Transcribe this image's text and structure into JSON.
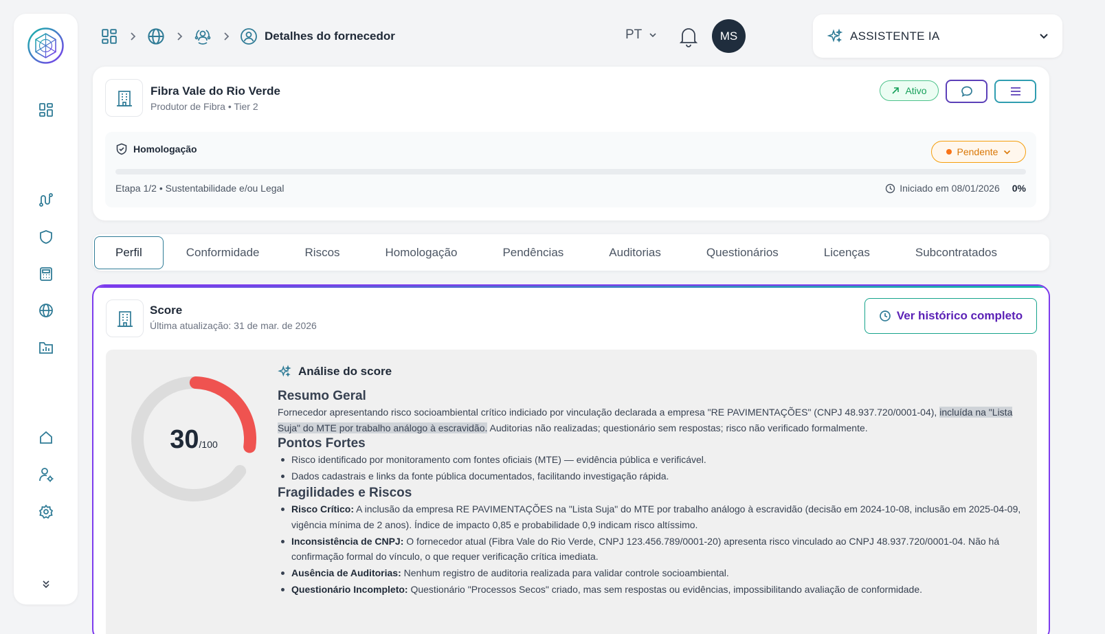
{
  "colors": {
    "accent": "#2f7b96",
    "purple": "#7c3aed",
    "teal": "#14b8a6",
    "danger": "#ef5350",
    "pending": "#d97706",
    "active": "#16a05a"
  },
  "sidebar": {
    "items": [
      {
        "name": "dashboard",
        "icon": "dashboard-icon"
      },
      {
        "name": "routes",
        "icon": "route-icon"
      },
      {
        "name": "shield",
        "icon": "shield-icon"
      },
      {
        "name": "calculator",
        "icon": "calculator-icon"
      },
      {
        "name": "globe",
        "icon": "globe-icon"
      },
      {
        "name": "reports",
        "icon": "chart-folder-icon"
      },
      {
        "name": "home",
        "icon": "home-icon"
      },
      {
        "name": "user-settings",
        "icon": "user-gear-icon"
      },
      {
        "name": "settings",
        "icon": "gear-icon"
      },
      {
        "name": "expand",
        "icon": "chevrons-down-icon"
      }
    ]
  },
  "header": {
    "breadcrumb_current": "Detalhes do fornecedor",
    "language": "PT",
    "avatar_initials": "MS",
    "assistant_label": "ASSISTENTE IA"
  },
  "supplier": {
    "name": "Fibra Vale do Rio Verde",
    "subtitle": "Produtor de Fibra • Tier 2",
    "status": "Ativo",
    "homologation": {
      "title": "Homologação",
      "status": "Pendente",
      "stage": "Etapa 1/2 • Sustentabilidade e/ou Legal",
      "started": "Iniciado em 08/01/2026",
      "percent_label": "0%",
      "progress": 0
    }
  },
  "tabs": [
    {
      "label": "Perfil",
      "active": true
    },
    {
      "label": "Conformidade",
      "active": false
    },
    {
      "label": "Riscos",
      "active": false
    },
    {
      "label": "Homologação",
      "active": false
    },
    {
      "label": "Pendências",
      "active": false
    },
    {
      "label": "Auditorias",
      "active": false
    },
    {
      "label": "Questionários",
      "active": false
    },
    {
      "label": "Licenças",
      "active": false
    },
    {
      "label": "Subcontratados",
      "active": false
    }
  ],
  "score": {
    "title": "Score",
    "updated": "Última atualização: 31 de mar. de 2026",
    "history_button": "Ver histórico completo",
    "value": 30,
    "value_label": "30",
    "max_label": "/100",
    "analysis_title": "Análise do score",
    "summary_title": "Resumo Geral",
    "summary_part1": "Fornecedor apresentando risco socioambiental crítico indiciado por vinculação declarada a empresa \"RE PAVIMENTAÇÕES\" (CNPJ 48.937.720/0001-04), ",
    "summary_highlight": "incluída na \"Lista Suja\" do MTE por trabalho análogo à escravidão.",
    "summary_part2": " Auditorias não realizadas; questionário sem respostas; risco não verificado formalmente.",
    "strengths_title": "Pontos Fortes",
    "strengths": [
      "Risco identificado por monitoramento com fontes oficiais (MTE) — evidência pública e verificável.",
      "Dados cadastrais e links da fonte pública documentados, facilitando investigação rápida."
    ],
    "weaknesses_title": "Fragilidades e Riscos",
    "weaknesses": [
      {
        "label": "Risco Crítico:",
        "text": " A inclusão da empresa RE PAVIMENTAÇÕES na \"Lista Suja\" do MTE por trabalho análogo à escravidão (decisão em 2024-10-08, inclusão em 2025-04-09, vigência mínima de 2 anos). Índice de impacto 0,85 e probabilidade 0,9 indicam risco altíssimo."
      },
      {
        "label": "Inconsistência de CNPJ:",
        "text": " O fornecedor atual (Fibra Vale do Rio Verde, CNPJ 123.456.789/0001-20) apresenta risco vinculado ao CNPJ 48.937.720/0001-04. Não há confirmação formal do vínculo, o que requer verificação crítica imediata."
      },
      {
        "label": "Ausência de Auditorias:",
        "text": " Nenhum registro de auditoria realizada para validar controle socioambiental."
      },
      {
        "label": "Questionário Incompleto:",
        "text": " Questionário \"Processos Secos\" criado, mas sem respostas ou evidências, impossibilitando avaliação de conformidade."
      }
    ]
  }
}
